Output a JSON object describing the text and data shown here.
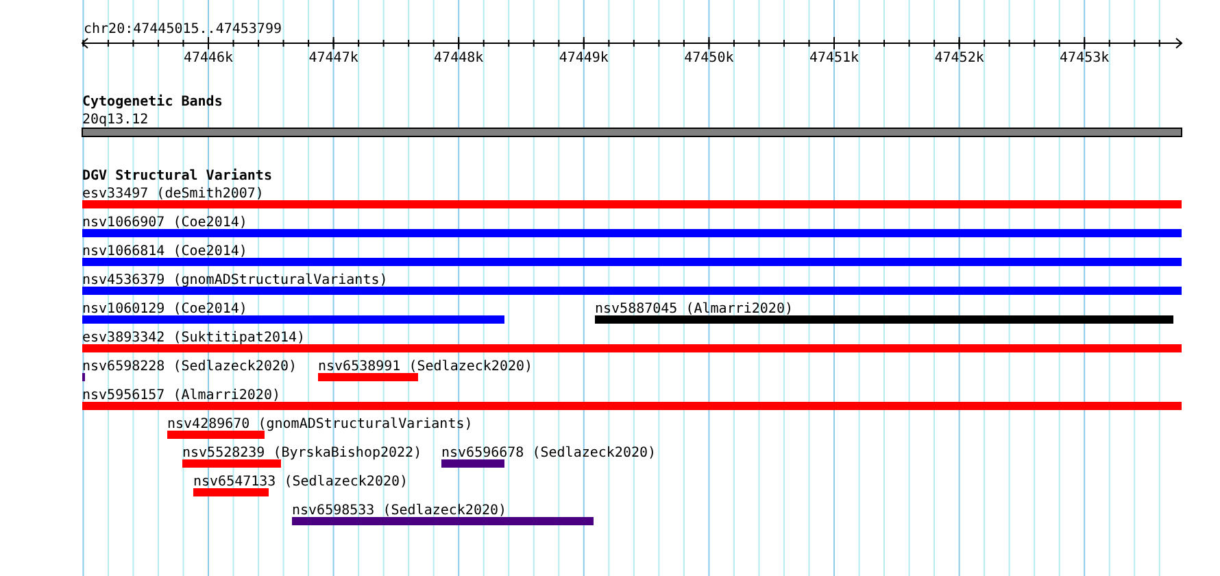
{
  "ruler": {
    "range": "chr20:47445015..47453799",
    "ticks": [
      "47446k",
      "47447k",
      "47448k",
      "47449k",
      "47450k",
      "47451k",
      "47452k",
      "47453k"
    ]
  },
  "cytogenetic_bands": {
    "title": "Cytogenetic Bands",
    "band": "20q13.12"
  },
  "structural_variants": {
    "title": "DGV Structural Variants",
    "rows": [
      {
        "features": [
          {
            "label": "esv33497 (deSmith2007)",
            "color": "#ff0000"
          }
        ]
      },
      {
        "features": [
          {
            "label": "nsv1066907 (Coe2014)",
            "color": "#0000ff"
          }
        ]
      },
      {
        "features": [
          {
            "label": "nsv1066814 (Coe2014)",
            "color": "#0000ff"
          }
        ]
      },
      {
        "features": [
          {
            "label": "nsv4536379 (gnomADStructuralVariants)",
            "color": "#0000ff"
          }
        ]
      },
      {
        "features": [
          {
            "label": "nsv1060129 (Coe2014)",
            "color": "#0000ff"
          },
          {
            "label": "nsv5887045 (Almarri2020)",
            "color": "#000000"
          }
        ]
      },
      {
        "features": [
          {
            "label": "esv3893342 (Suktitipat2014)",
            "color": "#ff0000"
          }
        ]
      },
      {
        "features": [
          {
            "label": "nsv6598228 (Sedlazeck2020)",
            "color": "#4b0082"
          },
          {
            "label": "nsv6538991 (Sedlazeck2020)",
            "color": "#ff0000"
          }
        ]
      },
      {
        "features": [
          {
            "label": "nsv5956157 (Almarri2020)",
            "color": "#ff0000"
          }
        ]
      },
      {
        "features": [
          {
            "label": "nsv4289670 (gnomADStructuralVariants)",
            "color": "#ff0000"
          }
        ]
      },
      {
        "features": [
          {
            "label": "nsv5528239 (ByrskaBishop2022)",
            "color": "#ff0000"
          },
          {
            "label": "nsv6596678 (Sedlazeck2020)",
            "color": "#4b0082"
          }
        ]
      },
      {
        "features": [
          {
            "label": "nsv6547133 (Sedlazeck2020)",
            "color": "#ff0000"
          }
        ]
      },
      {
        "features": [
          {
            "label": "nsv6598533 (Sedlazeck2020)",
            "color": "#4b0082"
          }
        ]
      }
    ]
  }
}
